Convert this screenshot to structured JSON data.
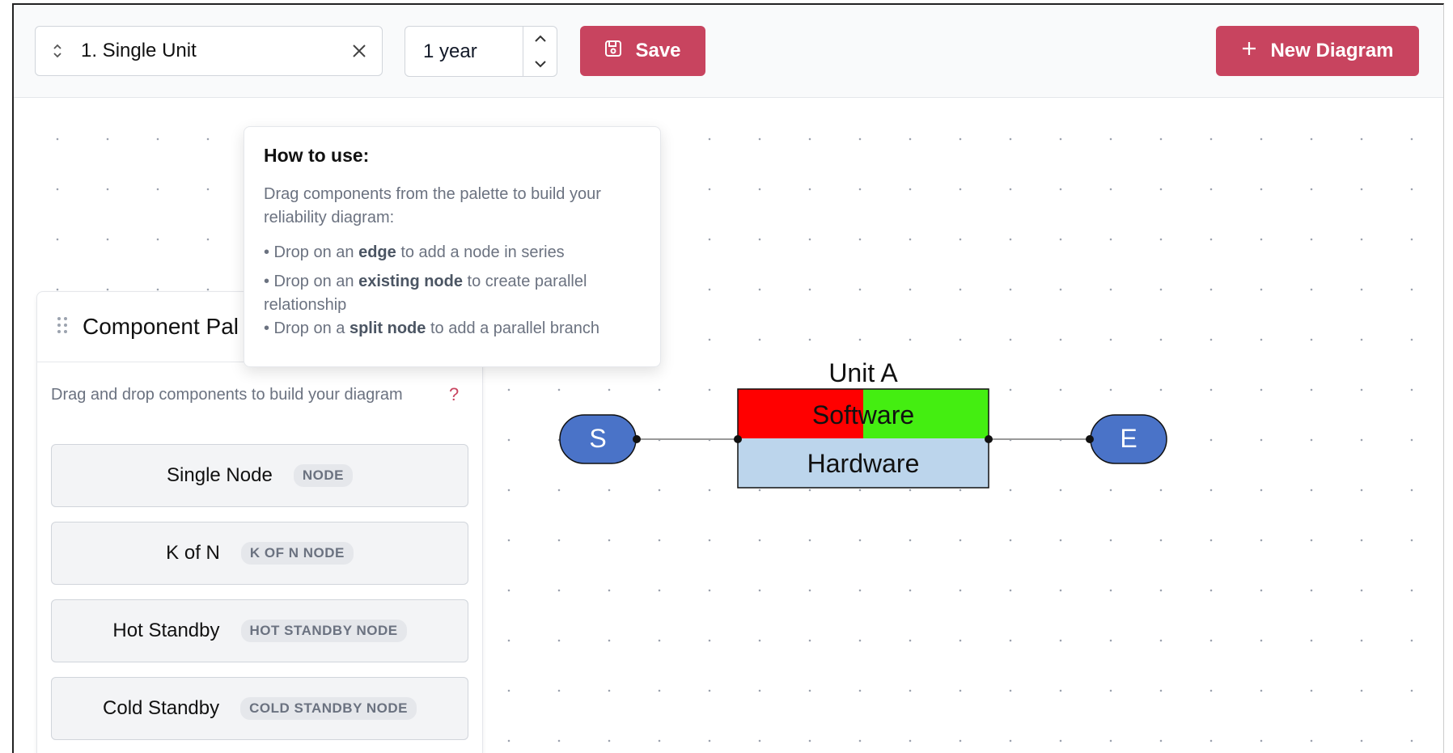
{
  "toolbar": {
    "select_value": "1. Single Unit",
    "duration_value": "1 year",
    "save_label": "Save",
    "new_label": "New Diagram",
    "accent": "#c8445f"
  },
  "tooltip": {
    "title": "How to use:",
    "body": "Drag components from the palette to build your reliability diagram:",
    "lines": [
      {
        "pre": "• Drop on an ",
        "bold": "edge",
        "post": " to add a node in series"
      },
      {
        "pre": "• Drop on an ",
        "bold": "existing node",
        "post": " to create parallel relationship"
      },
      {
        "pre": "• Drop on a ",
        "bold": "split node",
        "post": " to add a parallel branch"
      }
    ]
  },
  "palette": {
    "title": "Component Pal",
    "hint": "Drag and drop components to build your diagram",
    "help": "?",
    "items": [
      {
        "name": "Single Node",
        "tag": "NODE"
      },
      {
        "name": "K of N",
        "tag": "K OF N NODE"
      },
      {
        "name": "Hot Standby",
        "tag": "HOT STANDBY NODE"
      },
      {
        "name": "Cold Standby",
        "tag": "COLD STANDBY NODE"
      }
    ]
  },
  "diagram": {
    "start_label": "S",
    "end_label": "E",
    "unit_title": "Unit A",
    "software_label": "Software",
    "hardware_label": "Hardware",
    "colors": {
      "terminal": "#4a73c8",
      "software_fail": "#ff0000",
      "software_ok": "#44ee11",
      "hardware": "#bcd5ec"
    }
  }
}
